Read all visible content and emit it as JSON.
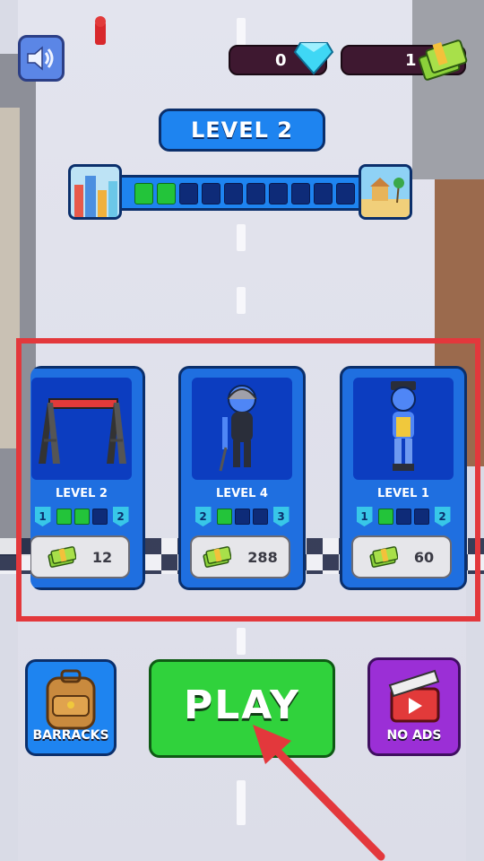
{
  "header": {
    "gem_count": "0",
    "cash_count": "1",
    "icons": [
      "speaker-icon",
      "diamond-icon",
      "cash-stack-icon"
    ]
  },
  "level": {
    "title": "LEVEL 2",
    "progress_filled": 2,
    "progress_total": 10
  },
  "cards": [
    {
      "level": "LEVEL 2",
      "from": "1",
      "to": "2",
      "filled": 3,
      "total": 4,
      "cost": "12",
      "art": "swing-set"
    },
    {
      "level": "LEVEL 4",
      "from": "2",
      "to": "3",
      "filled": 1,
      "total": 4,
      "cost": "288",
      "art": "helmet-soldier"
    },
    {
      "level": "LEVEL 1",
      "from": "1",
      "to": "2",
      "filled": 1,
      "total": 4,
      "cost": "60",
      "art": "yellow-vest-soldier"
    }
  ],
  "buttons": {
    "barracks": "BARRACKS",
    "play": "PLAY",
    "noads": "NO ADS"
  },
  "colors": {
    "accent_blue": "#1e84f0",
    "play_green": "#30d23c",
    "noads_purple": "#9b2fd6",
    "highlight_red": "#e3383c"
  }
}
